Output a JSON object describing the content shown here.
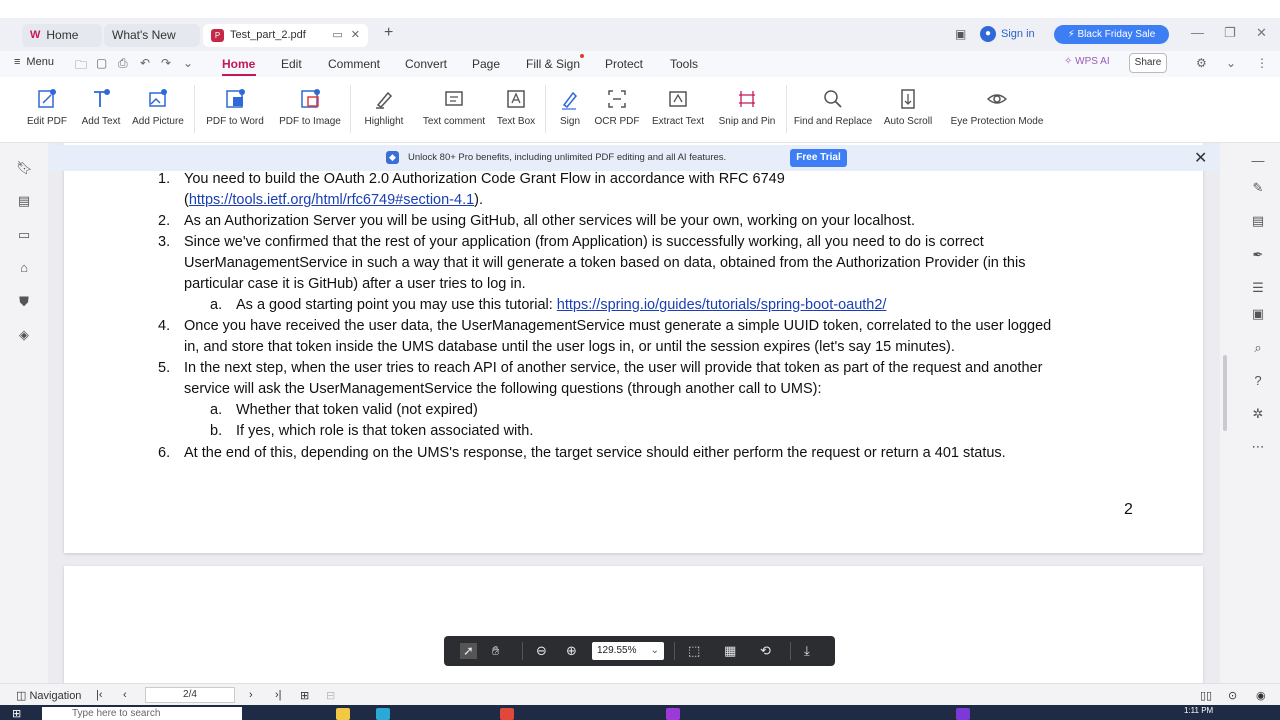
{
  "titlebar": {
    "tabs": [
      {
        "label": "Home"
      },
      {
        "label": "What's New"
      },
      {
        "label": "Test_part_2.pdf"
      }
    ],
    "sign_in": "Sign in",
    "promo": "Black Friday Sale"
  },
  "menubar": {
    "menu_label": "Menu",
    "items": [
      "Home",
      "Edit",
      "Comment",
      "Convert",
      "Page",
      "Fill & Sign",
      "Protect",
      "Tools"
    ],
    "active": "Home",
    "wps_ai": "WPS AI",
    "share": "Share"
  },
  "ribbon": {
    "buttons": [
      {
        "label": "Edit PDF",
        "icon": "edit-pdf-icon"
      },
      {
        "label": "Add Text",
        "icon": "add-text-icon"
      },
      {
        "label": "Add Picture",
        "icon": "add-picture-icon"
      },
      {
        "label": "PDF to Word",
        "icon": "pdf-to-word-icon"
      },
      {
        "label": "PDF to Image",
        "icon": "pdf-to-image-icon"
      },
      {
        "label": "Highlight",
        "icon": "highlight-icon"
      },
      {
        "label": "Text comment",
        "icon": "text-comment-icon"
      },
      {
        "label": "Text Box",
        "icon": "text-box-icon"
      },
      {
        "label": "Sign",
        "icon": "sign-icon"
      },
      {
        "label": "OCR PDF",
        "icon": "ocr-icon"
      },
      {
        "label": "Extract Text",
        "icon": "extract-text-icon"
      },
      {
        "label": "Snip and Pin",
        "icon": "snip-pin-icon"
      },
      {
        "label": "Find and Replace",
        "icon": "find-replace-icon"
      },
      {
        "label": "Auto Scroll",
        "icon": "auto-scroll-icon"
      },
      {
        "label": "Eye Protection Mode",
        "icon": "eye-protection-icon"
      }
    ]
  },
  "banner": {
    "text": "Unlock 80+ Pro benefits, including unlimited PDF editing and all AI features.",
    "cta": "Free Trial"
  },
  "document": {
    "items": [
      {
        "num": "1.",
        "lines": [
          "You need to build the OAuth 2.0 Authorization Code Grant Flow in accordance with RFC 6749"
        ],
        "link": "https://tools.ietf.org/html/rfc6749#section-4.1",
        "link_prefix": "(",
        "link_suffix": ")."
      },
      {
        "num": "2.",
        "lines": [
          "As an Authorization Server you will be using GitHub, all other services will be your own, working on your localhost."
        ]
      },
      {
        "num": "3.",
        "lines": [
          "Since we've confirmed that the rest of your application (from Application) is successfully working, all you need to do is correct",
          "UserManagementService in such a way that it will generate a token based on data, obtained from the Authorization Provider (in this",
          "particular case it is GitHub) after a user tries to log in."
        ]
      },
      {
        "num": "a.",
        "text": "As a good starting point you may use this tutorial: ",
        "link": "https://spring.io/guides/tutorials/spring-boot-oauth2/"
      },
      {
        "num": "4.",
        "lines": [
          "Once you have received the user data, the UserManagementService must generate a simple UUID token, correlated to the user logged",
          "in, and store that token inside the UMS database until the user logs in, or until the session expires (let's say 15 minutes)."
        ]
      },
      {
        "num": "5.",
        "lines": [
          "In the next step, when the user tries to reach API of another service, the user will provide that token as part of the request and another",
          "service will ask the UserManagementService the following questions (through another call to UMS):"
        ]
      },
      {
        "num": "a.",
        "text": "Whether that token valid (not expired)"
      },
      {
        "num": "b.",
        "text": "If yes, which role is that token associated with."
      },
      {
        "num": "6.",
        "lines": [
          "At the end of this, depending on the UMS's response, the target service should either perform the request or return a 401 status."
        ]
      }
    ],
    "page_number": "2"
  },
  "floatbar": {
    "zoom": "129.55%"
  },
  "statusbar": {
    "navigation": "Navigation",
    "page": "2/4"
  },
  "taskbar": {
    "search_placeholder": "Type here to search",
    "time": "1:11 PM"
  }
}
